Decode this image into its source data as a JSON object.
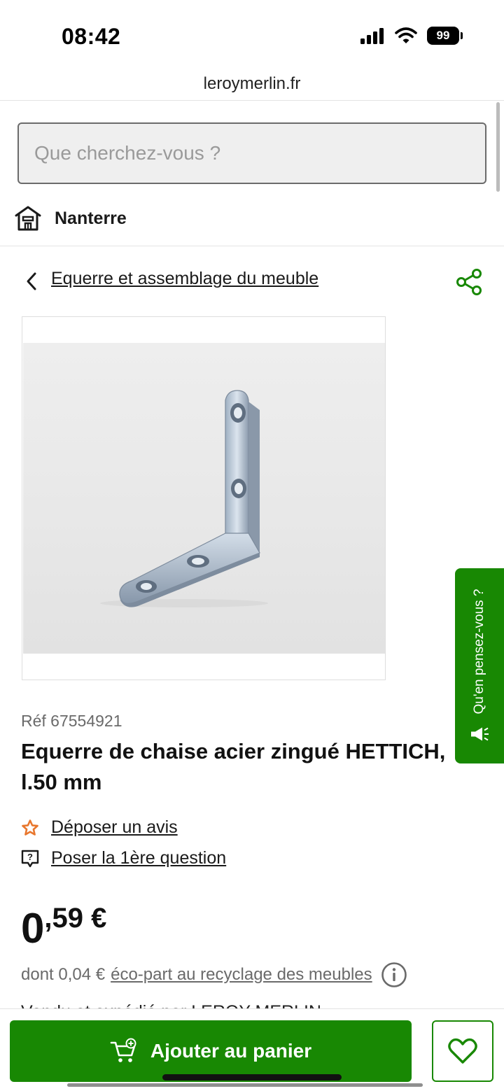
{
  "status_bar": {
    "time": "08:42",
    "battery": "99"
  },
  "browser": {
    "url": "leroymerlin.fr"
  },
  "search": {
    "placeholder": "Que cherchez-vous ?",
    "value": ""
  },
  "store": {
    "name": "Nanterre"
  },
  "breadcrumb": {
    "label": "Equerre et assemblage du meuble"
  },
  "feedback_tab": {
    "label": "Qu'en pensez-vous ?"
  },
  "product": {
    "ref": "Réf 67554921",
    "title": "Equerre de chaise acier zingué HETTICH, l.50 mm",
    "review_link": "Déposer un avis",
    "question_link": "Poser la 1ère question",
    "price_int": "0",
    "price_dec": ",59 €",
    "ecopart_prefix": "dont 0,04 €",
    "ecopart_link": "éco-part au recyclage des meubles",
    "seller_peek": "Vendu et expédié par LEROY MERLIN"
  },
  "actions": {
    "add_to_cart": "Ajouter au panier"
  },
  "colors": {
    "brand_green": "#188803",
    "review_star": "#e8772e"
  },
  "icons": [
    "store-icon",
    "chevron-left-icon",
    "share-icon",
    "megaphone-icon",
    "star-icon",
    "question-icon",
    "info-icon",
    "cart-add-icon",
    "heart-icon"
  ]
}
